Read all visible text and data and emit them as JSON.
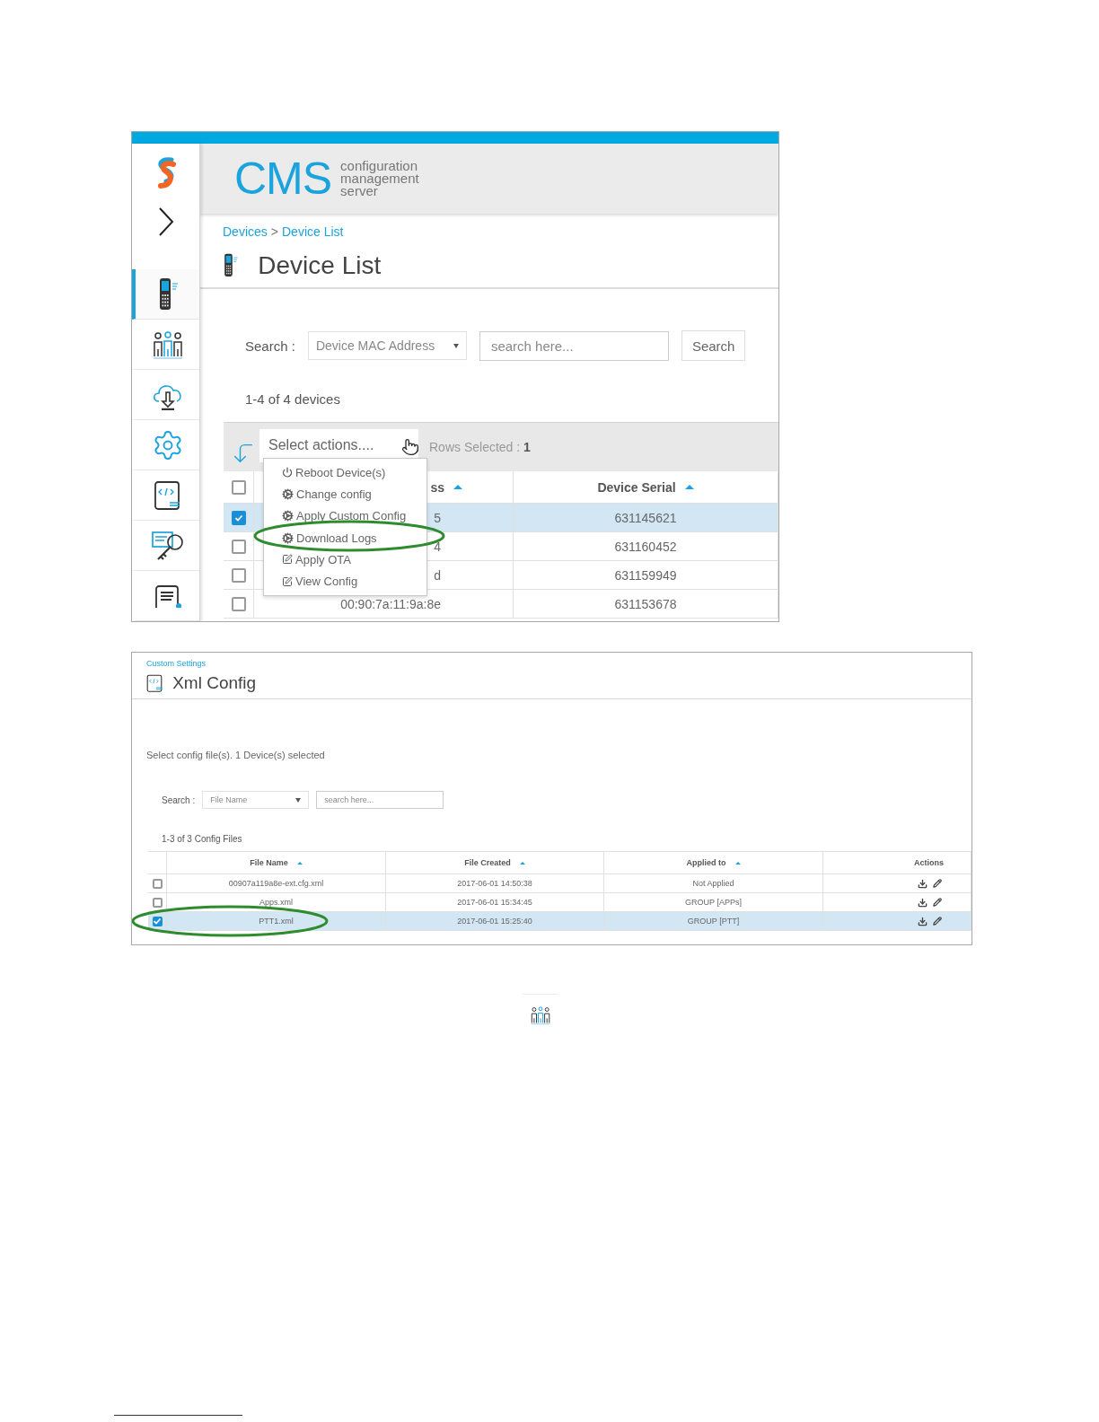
{
  "device_list_screen": {
    "logo": {
      "title": "CMS",
      "subtitle_lines": [
        "configuration",
        "management",
        "server"
      ]
    },
    "sidebar_items": [
      {
        "kind": "phone",
        "selected": true
      },
      {
        "kind": "people",
        "selected": false
      },
      {
        "kind": "cloud-download",
        "selected": false
      },
      {
        "kind": "gear",
        "selected": false
      },
      {
        "kind": "xml",
        "selected": false
      },
      {
        "kind": "key-search",
        "selected": false
      },
      {
        "kind": "document",
        "selected": false
      }
    ],
    "breadcrumb": {
      "items": [
        "Devices",
        "Device List"
      ],
      "separator": ">"
    },
    "title": "Device List",
    "search": {
      "label": "Search :",
      "field": "Device MAC Address",
      "placeholder": "search here...",
      "button": "Search"
    },
    "count": "1-4 of 4 devices",
    "actions_select": "Select actions....",
    "rows_selected": {
      "label": "Rows Selected :",
      "value": "1"
    },
    "header_checked": false,
    "columns": [
      "ss",
      "Device Serial"
    ],
    "rows": [
      {
        "checked": true,
        "mac": "5",
        "serial": "631145621"
      },
      {
        "checked": false,
        "mac": "4",
        "serial": "631160452"
      },
      {
        "checked": false,
        "mac": "d",
        "serial": "631159949"
      },
      {
        "checked": false,
        "mac": "00:90:7a:11:9a:8e",
        "serial": "631153678"
      }
    ],
    "action_menu": [
      {
        "kind": "power",
        "label": "Reboot Device(s)",
        "circled": false
      },
      {
        "kind": "gears",
        "label": "Change config",
        "circled": false
      },
      {
        "kind": "gears",
        "label": "Apply Custom Config",
        "circled": false
      },
      {
        "kind": "gears",
        "label": "Download Logs",
        "circled": true
      },
      {
        "kind": "edit",
        "label": "Apply OTA",
        "circled": false
      },
      {
        "kind": "edit",
        "label": "View Config",
        "circled": false
      }
    ]
  },
  "xml_config_screen": {
    "breadcrumb": "Custom Settings",
    "title": "Xml Config",
    "instruction": "Select config file(s). 1 Device(s) selected",
    "search": {
      "label": "Search :",
      "field": "File Name",
      "placeholder": "search here..."
    },
    "count": "1-3 of 3 Config Files",
    "columns": [
      {
        "label": "File Name",
        "sortable": true
      },
      {
        "label": "File Created",
        "sortable": true
      },
      {
        "label": "Applied to",
        "sortable": true
      },
      {
        "label": "Actions",
        "sortable": false
      }
    ],
    "rows": [
      {
        "checked": false,
        "circled": false,
        "file_name": "00907a119a8e-ext.cfg.xml",
        "created": "2017-06-01 14:50:38",
        "applied_to": "Not Applied"
      },
      {
        "checked": false,
        "circled": false,
        "file_name": "Apps.xml",
        "created": "2017-06-01 15:34:45",
        "applied_to": "GROUP [APPs]"
      },
      {
        "checked": true,
        "circled": true,
        "file_name": "PTT1.xml",
        "created": "2017-06-01 15:25:40",
        "applied_to": "GROUP [PTT]"
      }
    ]
  }
}
